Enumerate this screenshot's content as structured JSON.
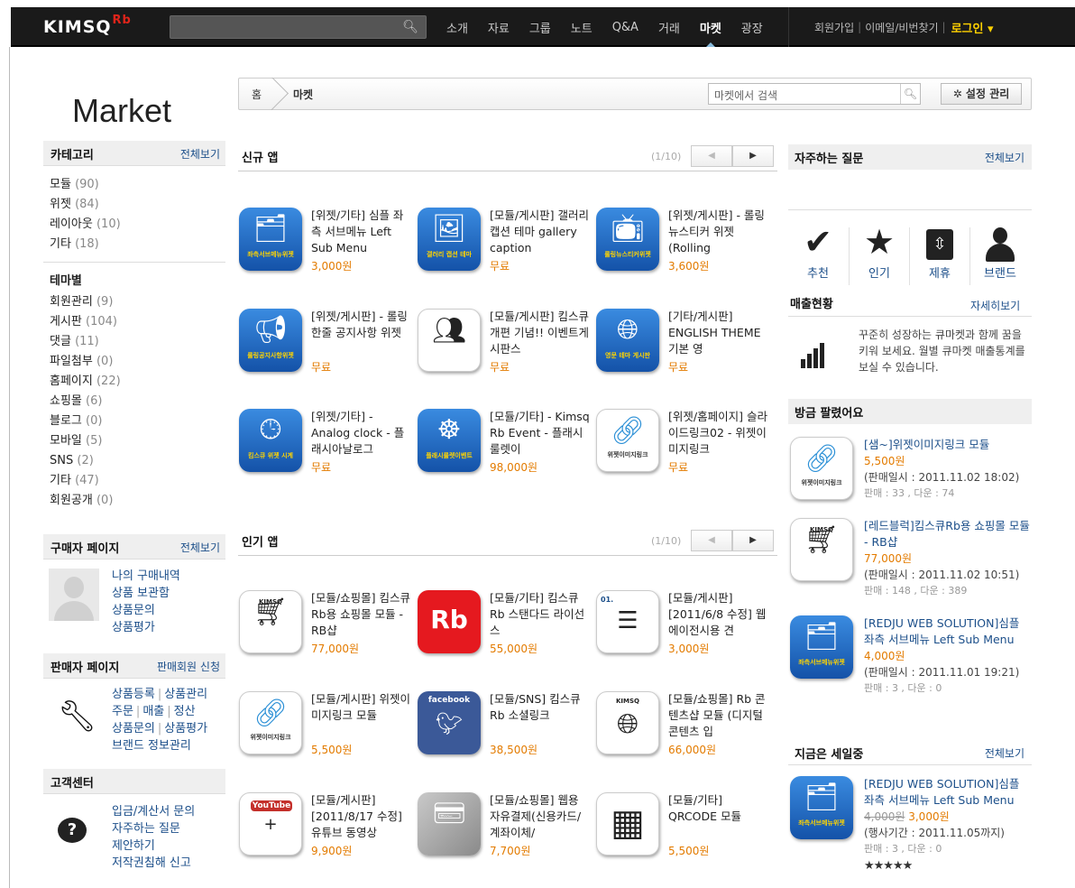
{
  "topbar": {
    "logo": "KIMSQ",
    "logo_sup": "Rb",
    "nav": [
      "소개",
      "자료",
      "그룹",
      "노트",
      "Q&A",
      "거래",
      "마켓",
      "광장"
    ],
    "active": "마켓",
    "signup": "회원가입",
    "find": "이메일/비번찾기",
    "login": "로그인 ▾"
  },
  "page_title": "Market",
  "breadcrumb": {
    "home": "홈",
    "current": "마켓",
    "search_placeholder": "마켓에서 검색",
    "settings": "✲ 설정 관리"
  },
  "sidebar": {
    "category": {
      "title": "카테고리",
      "more": "전체보기",
      "items": [
        {
          "label": "모듈",
          "count": "(90)"
        },
        {
          "label": "위젯",
          "count": "(84)"
        },
        {
          "label": "레이아웃",
          "count": "(10)"
        },
        {
          "label": "기타",
          "count": "(18)"
        }
      ]
    },
    "theme": {
      "title": "테마별",
      "items": [
        {
          "label": "회원관리",
          "count": "(9)"
        },
        {
          "label": "게시판",
          "count": "(104)"
        },
        {
          "label": "댓글",
          "count": "(11)"
        },
        {
          "label": "파일첨부",
          "count": "(0)"
        },
        {
          "label": "홈페이지",
          "count": "(22)"
        },
        {
          "label": "쇼핑몰",
          "count": "(6)"
        },
        {
          "label": "블로그",
          "count": "(0)"
        },
        {
          "label": "모바일",
          "count": "(5)"
        },
        {
          "label": "SNS",
          "count": "(2)"
        },
        {
          "label": "기타",
          "count": "(47)"
        },
        {
          "label": "회원공개",
          "count": "(0)"
        }
      ]
    },
    "buyer": {
      "title": "구매자 페이지",
      "more": "전체보기",
      "links": [
        "나의 구매내역",
        "상품 보관함",
        "상품문의",
        "상품평가"
      ]
    },
    "seller": {
      "title": "판매자 페이지",
      "more": "판매회원 신청",
      "rows": [
        [
          "상품등록",
          "상품관리"
        ],
        [
          "주문",
          "매출",
          "정산"
        ],
        [
          "상품문의",
          "상품평가"
        ],
        [
          "브랜드 정보관리"
        ]
      ]
    },
    "support": {
      "title": "고객센터",
      "links": [
        "입금/계산서 문의",
        "자주하는 질문",
        "제안하기",
        "저작권침해 신고"
      ]
    }
  },
  "new_apps": {
    "title": "신규 앱",
    "page": "(1/10)",
    "items": [
      {
        "text": "[위젯/기타] 심플 좌측 서브메뉴 Left Sub Menu",
        "price": "3,000원",
        "band": "좌측서브메뉴위젯"
      },
      {
        "text": "[모듈/게시판] 갤러리 캡션 테마 gallery caption",
        "price": "무료",
        "band": "갤러리 캡션 테마"
      },
      {
        "text": "[위젯/게시판] - 롤링 뉴스티커 위젯 (Rolling",
        "price": "3,600원",
        "band": "롤링뉴스티커위젯"
      },
      {
        "text": "[위젯/게시판] - 롤링 한줄 공지사항 위젯",
        "price": "무료",
        "band": "롤링공지사항위젯"
      },
      {
        "text": "[모듈/게시판] 킴스큐 개편 기념!! 이벤트게시판스",
        "price": "무료",
        "band": ""
      },
      {
        "text": "[기타/게시판] ENGLISH THEME 기본 영",
        "price": "무료",
        "band": "영문 테마 게시판"
      },
      {
        "text": "[위젯/기타] - Analog clock - 플래시아날로그",
        "price": "무료",
        "band": "킴스큐 위젯 시계"
      },
      {
        "text": "[모듈/기타] - Kimsq Rb Event - 플래시 룰렛이",
        "price": "98,000원",
        "band": "플래시룰렛이벤트"
      },
      {
        "text": "[위젯/홈페이지] 슬라이드링크02 - 위젯이미지링크",
        "price": "무료",
        "band": "위젯이미지링크"
      }
    ]
  },
  "popular_apps": {
    "title": "인기 앱",
    "page": "(1/10)",
    "items": [
      {
        "text": "[모듈/쇼핑몰] 킴스큐Rb용 쇼핑몰 모듈 - RB샵",
        "price": "77,000원",
        "band": "KIMSQ"
      },
      {
        "text": "[모듈/기타] 킴스큐Rb 스탠다드 라이선스",
        "price": "55,000원",
        "band": "Rb"
      },
      {
        "text": "[모듈/게시판] [2011/6/8 수정] 웹에이전시용 견",
        "price": "3,000원",
        "band": "01."
      },
      {
        "text": "[모듈/게시판] 위젯이미지링크 모듈",
        "price": "5,500원",
        "band": "위젯이미지링크"
      },
      {
        "text": "[모듈/SNS] 킴스큐Rb 소셜링크",
        "price": "38,500원",
        "band": "facebook"
      },
      {
        "text": "[모듈/쇼핑몰] Rb 콘텐츠샵 모듈 (디지털콘텐츠 입",
        "price": "66,000원",
        "band": "KIMSQ"
      },
      {
        "text": "[모듈/게시판] [2011/8/17 수정] 유튜브 동영상",
        "price": "9,900원",
        "band": "YouTube"
      },
      {
        "text": "[모듈/쇼핑몰] 웹용 자유결제(신용카드/계좌이체/",
        "price": "7,700원",
        "band": ""
      },
      {
        "text": "[모듈/기타] QRCODE 모듈",
        "price": "5,500원",
        "band": ""
      }
    ]
  },
  "faq": {
    "title": "자주하는 질문",
    "more": "전체보기",
    "quick": [
      "추천",
      "인기",
      "제휴",
      "브랜드"
    ]
  },
  "sales": {
    "title": "매출현황",
    "more": "자세히보기",
    "text": "꾸준히 성장하는 큐마켓과 함께 꿈을 키워 보세요. 월별 큐마켓 매출통계를 보실 수 있습니다."
  },
  "recent": {
    "title": "방금 팔렸어요",
    "items": [
      {
        "name": "[샘~]위젯이미지링크 모듈",
        "price": "5,500원",
        "date": "(판매일시 : 2011.11.02 18:02)",
        "count": "판매 : 33 , 다운 : 74",
        "band": "위젯이미지링크"
      },
      {
        "name": "[레드블럭]킴스큐Rb용 쇼핑몰 모듈 - RB샵",
        "price": "77,000원",
        "date": "(판매일시 : 2011.11.02 10:51)",
        "count": "판매 : 148 , 다운 : 389",
        "band": "KIMSQ"
      },
      {
        "name": "[REDJU WEB SOLUTION]심플 좌측 서브메뉴 Left Sub Menu",
        "price": "4,000원",
        "date": "(판매일시 : 2011.11.01 19:21)",
        "count": "판매 : 3 , 다운 : 0",
        "band": "좌측서브메뉴위젯"
      }
    ]
  },
  "sale": {
    "title": "지금은 세일중",
    "more": "전체보기",
    "name": "[REDJU WEB SOLUTION]심플 좌측 서브메뉴 Left Sub Menu",
    "old_price": "4,000원",
    "price": "3,000원",
    "period": "(행사기간 : 2011.11.05까지)",
    "count": "판매 : 3 , 다운 : 0",
    "stars": "★★★★★",
    "band": "좌측서브메뉴위젯"
  }
}
